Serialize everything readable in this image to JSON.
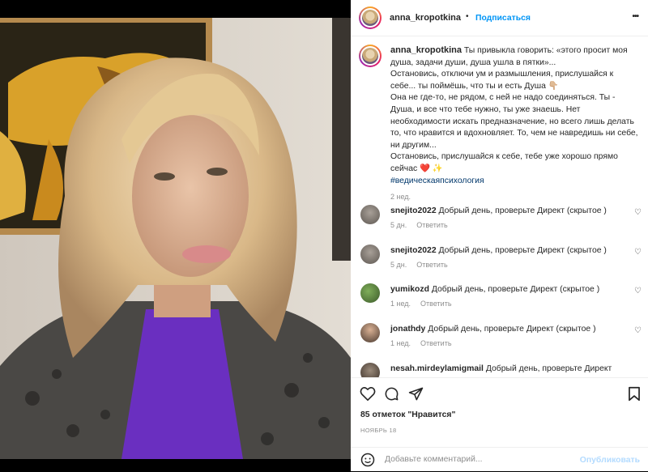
{
  "post": {
    "username": "anna_kropotkina",
    "follow_label": "Подписаться",
    "more_label": "•••",
    "dot": "•"
  },
  "caption": {
    "lines": [
      "Ты привыкла говорить: «этого просит моя",
      "душа, задачи души, душа ушла в пятки»...",
      "Остановись, отключи ум и размышления, прислушайся к",
      "себе... ты поймёшь, что ты и есть Душа 👇🏼",
      "Она не где-то, не рядом, с ней не надо соединяться. Ты -",
      "Душа, и все что тебе нужно, ты уже знаешь. Нет",
      "необходимости искать предназначение, но всего лишь делать",
      "то, что нравится и вдохновляет. То, чем не навредишь ни себе,",
      "ни другим...",
      "Остановись, прислушайся к себе, тебе уже хорошо прямо",
      "сейчас ❤️ ✨"
    ],
    "hashtag": "#ведическаяпсихология",
    "time": "2 нед."
  },
  "comments": [
    {
      "user": "snejito2022",
      "text": "Добрый день, проверьте Директ (скрытое )",
      "time": "5 дн.",
      "reply": "Ответить"
    },
    {
      "user": "snejito2022",
      "text": "Добрый день, проверьте Директ (скрытое )",
      "time": "5 дн.",
      "reply": "Ответить"
    },
    {
      "user": "yumikozd",
      "text": "Добрый день, проверьте Директ (скрытое )",
      "time": "1 нед.",
      "reply": "Ответить"
    },
    {
      "user": "jonathdy",
      "text": "Добрый день, проверьте Директ (скрытое )",
      "time": "1 нед.",
      "reply": "Ответить"
    },
    {
      "user": "nesah.mirdeylamigmail",
      "text": "Добрый день, проверьте Директ",
      "time": "",
      "reply": ""
    }
  ],
  "likes": "85 отметок \"Нравится\"",
  "date": "НОЯБРЬ 18",
  "add_comment": {
    "placeholder": "Добавьте комментарий...",
    "post_label": "Опубликовать"
  },
  "colors": {
    "accent": "#0095f6",
    "text": "#262626",
    "muted": "#8e8e8e",
    "like_red": "#ed4956"
  }
}
